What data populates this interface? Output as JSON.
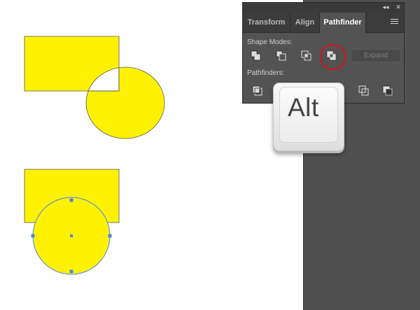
{
  "panel": {
    "collapse_glyph": "◂◂",
    "close_glyph": "✕",
    "tabs": [
      {
        "label": "Transform"
      },
      {
        "label": "Align"
      },
      {
        "label": "Pathfinder"
      }
    ],
    "active_tab": "Pathfinder",
    "shape_modes_label": "Shape Modes:",
    "pathfinders_label": "Pathfinders:",
    "expand_label": "Expand",
    "shape_mode_icons": [
      "unite-icon",
      "minus-front-icon",
      "intersect-icon",
      "exclude-icon"
    ],
    "pathfinder_icons": [
      "divide-icon",
      "trim-icon",
      "merge-icon",
      "crop-icon",
      "outline-icon",
      "minus-back-icon"
    ],
    "highlighted_button": "exclude-icon"
  },
  "keycap": {
    "label": "Alt"
  },
  "colors": {
    "shape_fill": "#fff200",
    "selection": "#4a86e8",
    "highlight_ring": "#d3141b",
    "panel_bg": "#535353",
    "canvas_bg": "#505050"
  }
}
